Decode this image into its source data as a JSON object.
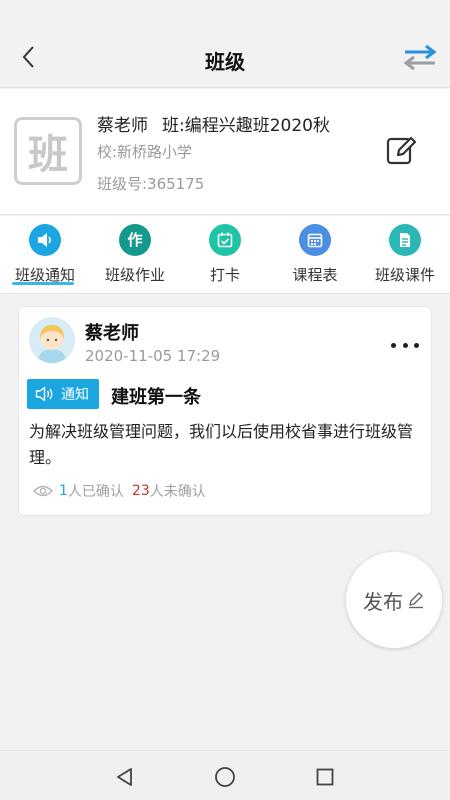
{
  "header": {
    "title": "班级",
    "back_icon": "chevron-left-icon",
    "switch_icon": "swap-arrows-icon"
  },
  "class_info": {
    "logo_char": "班",
    "teacher": "蔡老师",
    "class_name": "班:编程兴趣班2020秋",
    "school": "校:新桥路小学",
    "class_number": "班级号:365175",
    "edit_icon": "edit-icon"
  },
  "tabs": [
    {
      "label": "班级通知",
      "icon": "speaker-icon",
      "color": "#1ba6e0",
      "active": true
    },
    {
      "label": "班级作业",
      "icon": "homework-icon",
      "color": "#139a8d",
      "active": false
    },
    {
      "label": "打卡",
      "icon": "checkin-icon",
      "color": "#1fc3a6",
      "active": false
    },
    {
      "label": "课程表",
      "icon": "calendar-icon",
      "color": "#4a8fe3",
      "active": false
    },
    {
      "label": "班级课件",
      "icon": "document-icon",
      "color": "#2bb7b5",
      "active": false
    }
  ],
  "post": {
    "author": "蔡老师",
    "time": "2020-11-05 17:29",
    "badge": "通知",
    "title": "建班第一条",
    "body": "为解决班级管理问题，我们以后使用校省事进行班级管理。",
    "confirmed_count": "1",
    "confirmed_text": "人已确认",
    "unconfirmed_count": "23",
    "unconfirmed_text": "人未确认"
  },
  "fab": {
    "label": "发布",
    "icon": "pencil-icon"
  },
  "colors": {
    "accent": "#1ba6e0",
    "unconfirmed": "#c0392b"
  }
}
